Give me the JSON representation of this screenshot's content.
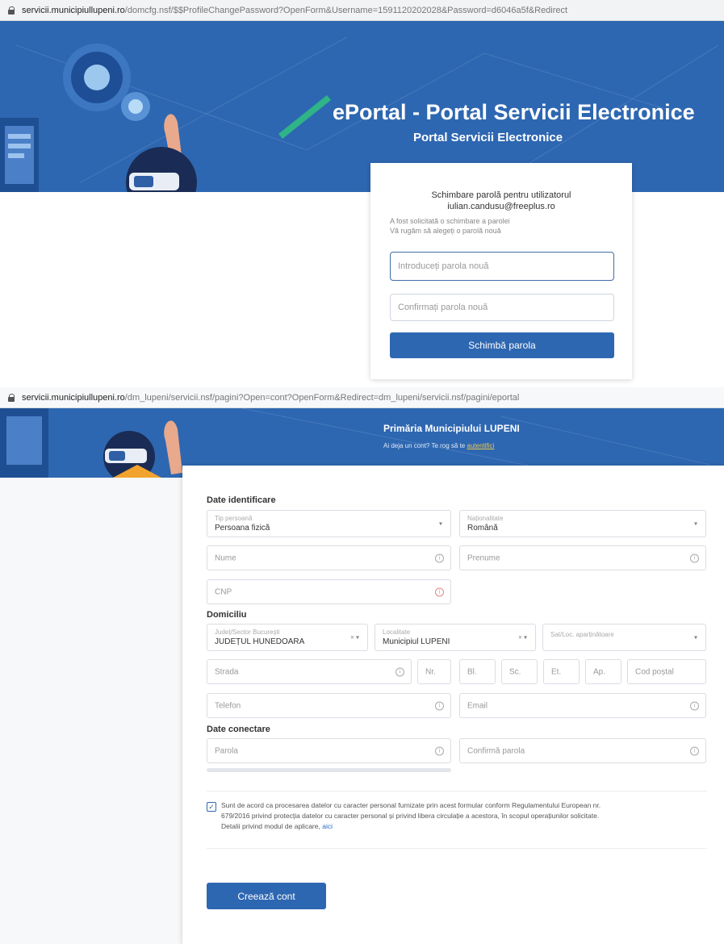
{
  "top_url": {
    "host": "servicii.municipiullupeni.ro",
    "path": "/domcfg.nsf/$$ProfileChangePassword?OpenForm&Username=1591120202028&Password=d6046a5f&Redirect"
  },
  "top_banner": {
    "title": "ePortal - Portal Servicii Electronice",
    "subtitle": "Portal Servicii Electronice"
  },
  "password_card": {
    "heading_line1": "Schimbare parolă pentru utilizatorul",
    "heading_line2": "iulian.candusu@freeplus.ro",
    "info_line1": "A fost solicitată o schimbare a parolei",
    "info_line2": "Vă rugăm să alegeți o parolă nouă",
    "new_password_placeholder": "Introduceți parola nouă",
    "confirm_password_placeholder": "Confirmați parola nouă",
    "submit_label": "Schimbă parola"
  },
  "bottom_url": {
    "host": "servicii.municipiullupeni.ro",
    "path": "/dm_lupeni/servicii.nsf/pagini?Open=cont?OpenForm&Redirect=dm_lupeni/servicii.nsf/pagini/eportal"
  },
  "bottom_banner": {
    "title": "Primăria Municipiului LUPENI",
    "login_prompt": "Ai deja un cont? Te rog să te",
    "login_link": "autentifici"
  },
  "form": {
    "identification_title": "Date identificare",
    "person_type_label": "Tip persoană",
    "person_type_value": "Persoana fizică",
    "nationality_label": "Naționalitate",
    "nationality_value": "Română",
    "name_placeholder": "Nume",
    "first_name_placeholder": "Prenume",
    "cnp_placeholder": "CNP",
    "domicile_title": "Domiciliu",
    "county_label": "Județ/Sector București",
    "county_value": "JUDEȚUL HUNEDOARA",
    "locality_label": "Localitate",
    "locality_value": "Municipiul LUPENI",
    "village_placeholder": "Sat/Loc. aparținătoare",
    "street_placeholder": "Strada",
    "number_placeholder": "Nr.",
    "block_placeholder": "Bl.",
    "entrance_placeholder": "Sc.",
    "floor_placeholder": "Et.",
    "apartment_placeholder": "Ap.",
    "postal_code_placeholder": "Cod poștal",
    "phone_placeholder": "Telefon",
    "email_placeholder": "Email",
    "connection_title": "Date conectare",
    "password_placeholder": "Parola",
    "confirm_password_placeholder": "Confirmă parola",
    "consent_line1": "Sunt de acord ca procesarea datelor cu caracter personal furnizate prin acest formular conform Regulamentului European nr.",
    "consent_line2": "679/2016 privind protecția datelor cu caracter personal și privind libera circulație a acestora, în scopul operațiunilor solicitate.",
    "consent_line3": "Detalii privind modul de aplicare,",
    "consent_link": "aici",
    "submit_label": "Creează cont",
    "info_glyph": "i",
    "caret_glyph": "▾",
    "select_clear_glyph": "× ▾",
    "check_glyph": "✓"
  },
  "colors": {
    "brand_blue": "#2e67b1",
    "link": "#2b6cc4"
  }
}
